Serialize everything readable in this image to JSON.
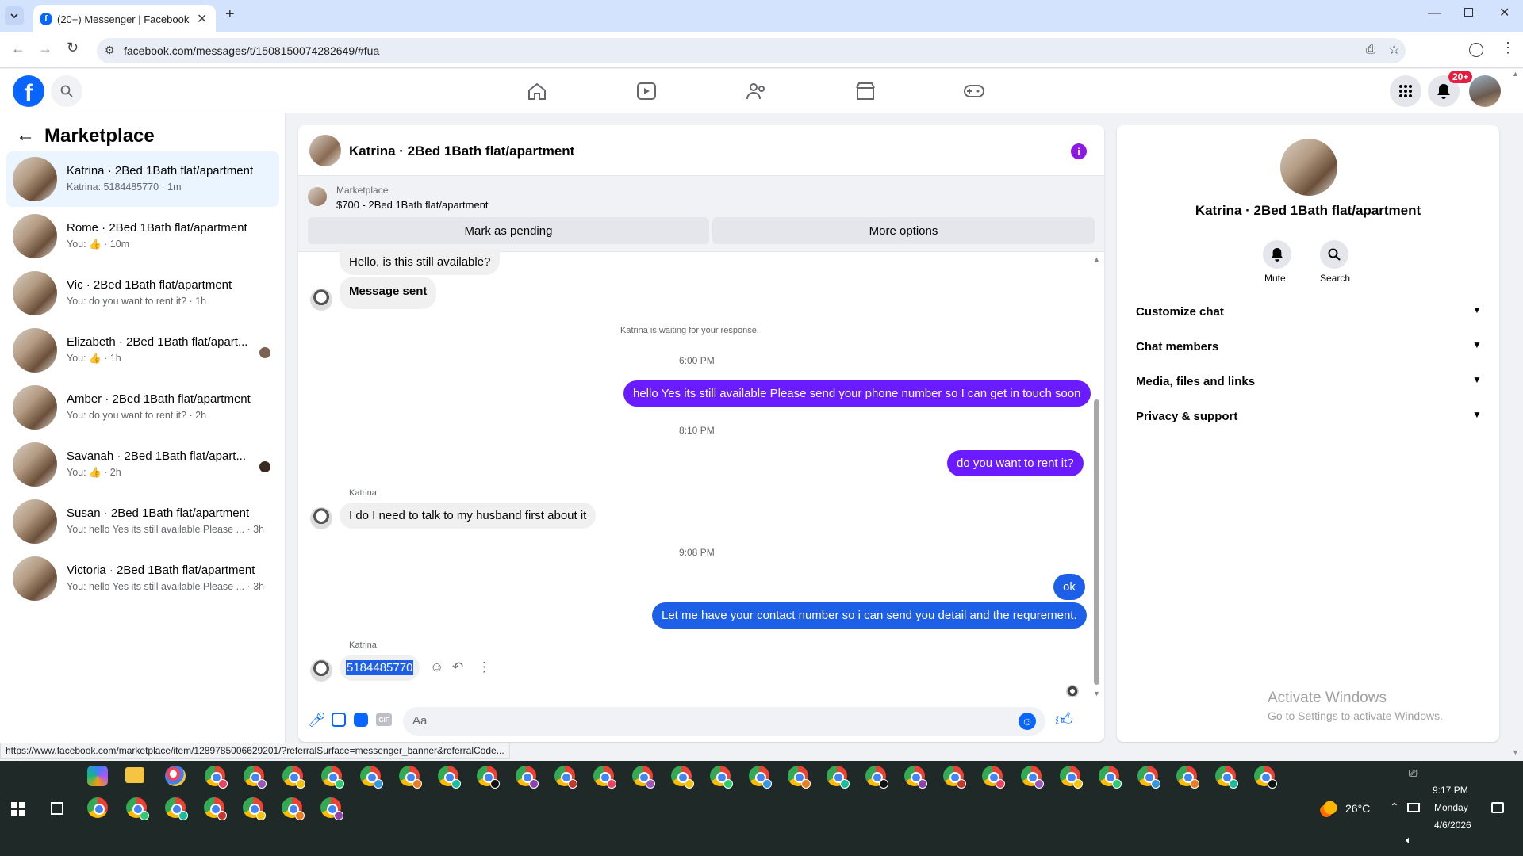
{
  "browser": {
    "tab_title": "(20+) Messenger | Facebook",
    "url": "facebook.com/messages/t/1508150074282649/#fua",
    "status_url": "https://www.facebook.com/marketplace/item/1289785006629201/?referralSurface=messenger_banner&referralCode..."
  },
  "header": {
    "notif_badge": "20+"
  },
  "sidebar": {
    "title": "Marketplace",
    "conversations": [
      {
        "name": "Katrina · 2Bed 1Bath flat/apartment",
        "preview": "Katrina: 5184485770 · 1m",
        "active": true
      },
      {
        "name": "Rome · 2Bed 1Bath flat/apartment",
        "preview_prefix": "You:",
        "preview_suffix": "· 10m"
      },
      {
        "name": "Vic · 2Bed 1Bath flat/apartment",
        "preview": "You: do you want to rent it? · 1h"
      },
      {
        "name": "Elizabeth · 2Bed 1Bath flat/apart...",
        "preview_prefix": "You:",
        "preview_suffix": "· 1h"
      },
      {
        "name": "Amber · 2Bed 1Bath flat/apartment",
        "preview": "You: do you want to rent it? · 2h"
      },
      {
        "name": "Savanah · 2Bed 1Bath flat/apart...",
        "preview_prefix": "You:",
        "preview_suffix": "· 2h"
      },
      {
        "name": "Susan · 2Bed 1Bath flat/apartment",
        "preview": "You: hello Yes its still available Please ... · 3h"
      },
      {
        "name": "Victoria · 2Bed 1Bath flat/apartment",
        "preview": "You: hello Yes its still available Please ... · 3h"
      }
    ]
  },
  "chat": {
    "title": "Katrina · 2Bed 1Bath flat/apartment",
    "listing_label": "Marketplace",
    "listing_title": "$700 - 2Bed 1Bath flat/apartment",
    "mark_pending": "Mark as pending",
    "more_options": "More options",
    "messages": {
      "m1": "Hello, is this still available?",
      "m2": "Message sent",
      "waiting": "Katrina is waiting for your response.",
      "t1": "6:00 PM",
      "m3": "hello Yes its still available Please send your phone number so I can get in touch soon",
      "t2": "8:10 PM",
      "m4": "do you want to rent it?",
      "sender1": "Katrina",
      "m5": "I do I need to talk to my husband first about it",
      "t3": "9:08 PM",
      "m6": "ok",
      "m7": "Let me have your contact number so i can send you detail and the requrement.",
      "sender2": "Katrina",
      "m8": "5184485770"
    },
    "composer_placeholder": "Aa"
  },
  "details": {
    "title": "Katrina · 2Bed 1Bath flat/apartment",
    "mute": "Mute",
    "search": "Search",
    "sections": [
      "Customize chat",
      "Chat members",
      "Media, files and links",
      "Privacy & support"
    ],
    "watermark_title": "Activate Windows",
    "watermark_sub": "Go to Settings to activate Windows."
  },
  "taskbar": {
    "weather": "26°C",
    "time": "9:17 PM",
    "day": "Monday",
    "date": "4/6/2026"
  },
  "colors": {
    "accent": "#6a1bff",
    "fb_blue": "#0866ff",
    "out_blue": "#1d5fe6"
  }
}
